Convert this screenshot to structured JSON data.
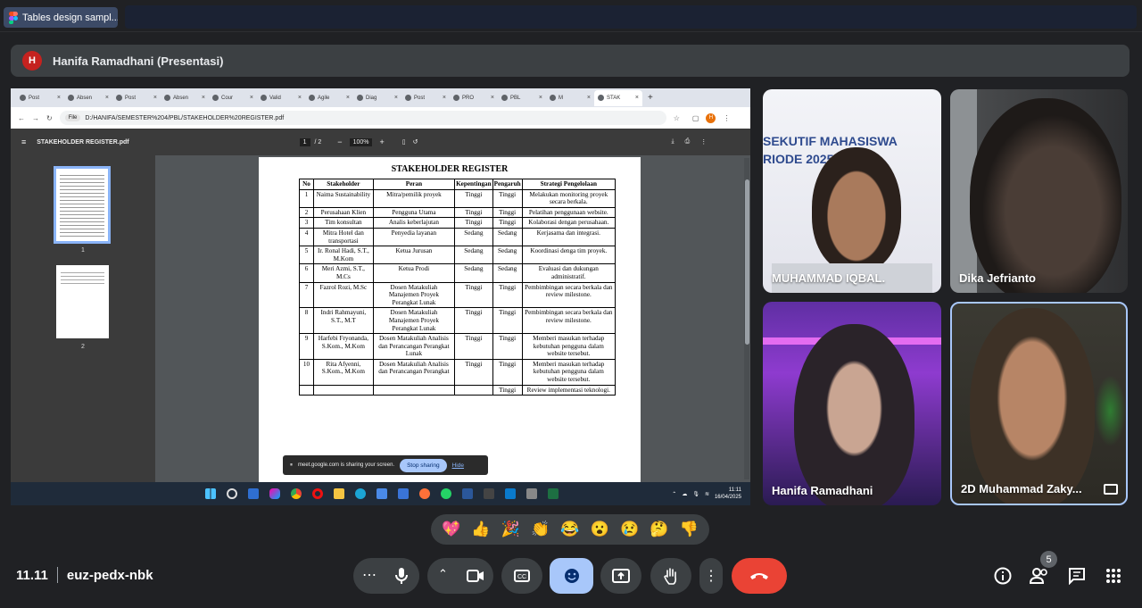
{
  "top_tab": {
    "label": "Tables design sampl..."
  },
  "presenter": {
    "initial": "H",
    "label": "Hanifa Ramadhani (Presentasi)"
  },
  "browser": {
    "tabs": [
      "Post",
      "Absen",
      "Post",
      "Absen",
      "Cour",
      "Valid",
      "Agile",
      "Diag",
      "Post",
      "PRO",
      "PBL",
      "M",
      "STAK"
    ],
    "address_chip": "File",
    "url": "D:/HANIFA/SEMESTER%204/PBL/STAKEHOLDER%20REGISTER.pdf",
    "profile_initial": "H"
  },
  "pdf": {
    "filename": "STAKEHOLDER REGISTER.pdf",
    "page_current": "1",
    "page_total": "/  2",
    "zoom": "100%",
    "thumb_labels": [
      "1",
      "2"
    ],
    "title": "STAKEHOLDER REGISTER",
    "headers": [
      "No",
      "Stakeholder",
      "Peran",
      "Kepentingan",
      "Pengaruh",
      "Strategi Pengelolaan"
    ],
    "rows": [
      [
        "1",
        "Naima Sustainability",
        "Mitra/pemilik proyek",
        "Tinggi",
        "Tinggi",
        "Melakukan monitoring proyek secara berkala."
      ],
      [
        "2",
        "Perusahaan Klien",
        "Pengguna Utama",
        "Tinggi",
        "Tinggi",
        "Pelatihan penggunaan website."
      ],
      [
        "3",
        "Tim konsultan",
        "Analis keberlajutan",
        "Tinggi",
        "Tinggi",
        "Kolaborasi dengan perusahaan."
      ],
      [
        "4",
        "Mitra Hotel dan transportasi",
        "Penyedia layanan",
        "Sedang",
        "Sedang",
        "Kerjasama dan integrasi."
      ],
      [
        "5",
        "Ir. Ronal Hadi, S.T., M.Kom",
        "Ketua Jurusan",
        "Sedang",
        "Sedang",
        "Koordinasi denga tim proyek."
      ],
      [
        "6",
        "Meri Azmi, S.T., M.Cs",
        "Ketua Prodi",
        "Sedang",
        "Sedang",
        "Evaluasi dan dukungan administratif."
      ],
      [
        "7",
        "Fazrol Rozi, M.Sc",
        "Dosen Matakuliah Manajemen Proyek Perangkat Lunak",
        "Tinggi",
        "Tinggi",
        "Pembimbingan secara berkala dan review milestone."
      ],
      [
        "8",
        "Indri Rahmayuni, S.T., M.T",
        "Dosen Matakuliah Manajemen Proyek Perangkat Lunak",
        "Tinggi",
        "Tinggi",
        "Pembimbingan secara berkala dan review milestone."
      ],
      [
        "9",
        "Harfebi Fryonanda, S.Kom., M.Kom",
        "Dosen Matakuliah Analisis dan Perancangan Perangkat Lunak",
        "Tinggi",
        "Tinggi",
        "Memberi masukan terhadap kebutuhan pengguna dalam website tersebut."
      ],
      [
        "10",
        "Rita Afyenni, S.Kom., M.Kom",
        "Dosen Matakuliah Analisis dan Perancangan Perangkat",
        "Tinggi",
        "Tinggi",
        "Memberi masukan terhadap kebutuhan pengguna dalam website tersebut."
      ],
      [
        "",
        "",
        "",
        "",
        "Tinggi",
        "Review implementasi teknologi."
      ]
    ],
    "share_text": "meet.google.com is sharing your screen.",
    "stop_label": "Stop sharing",
    "hide_label": "Hide"
  },
  "taskbar": {
    "time": "11:11",
    "date": "16/04/2025"
  },
  "participants": [
    {
      "name": "MUHAMMAD IQBAL.",
      "banner": "SEKUTIF MAHASISWA",
      "banner2": "RIODE 2025"
    },
    {
      "name": "Dika Jefrianto"
    },
    {
      "name": "Hanifa Ramadhani"
    },
    {
      "name": "2D Muhammad Zaky..."
    }
  ],
  "reactions": [
    "💖",
    "👍",
    "🎉",
    "👏",
    "😂",
    "😮",
    "😢",
    "🤔",
    "👎"
  ],
  "meeting": {
    "time": "11.11",
    "code": "euz-pedx-nbk"
  },
  "people_count": "5",
  "colors": {
    "end_call": "#ea4335",
    "emoji_active": "#a8c7fa",
    "background": "#202124"
  }
}
